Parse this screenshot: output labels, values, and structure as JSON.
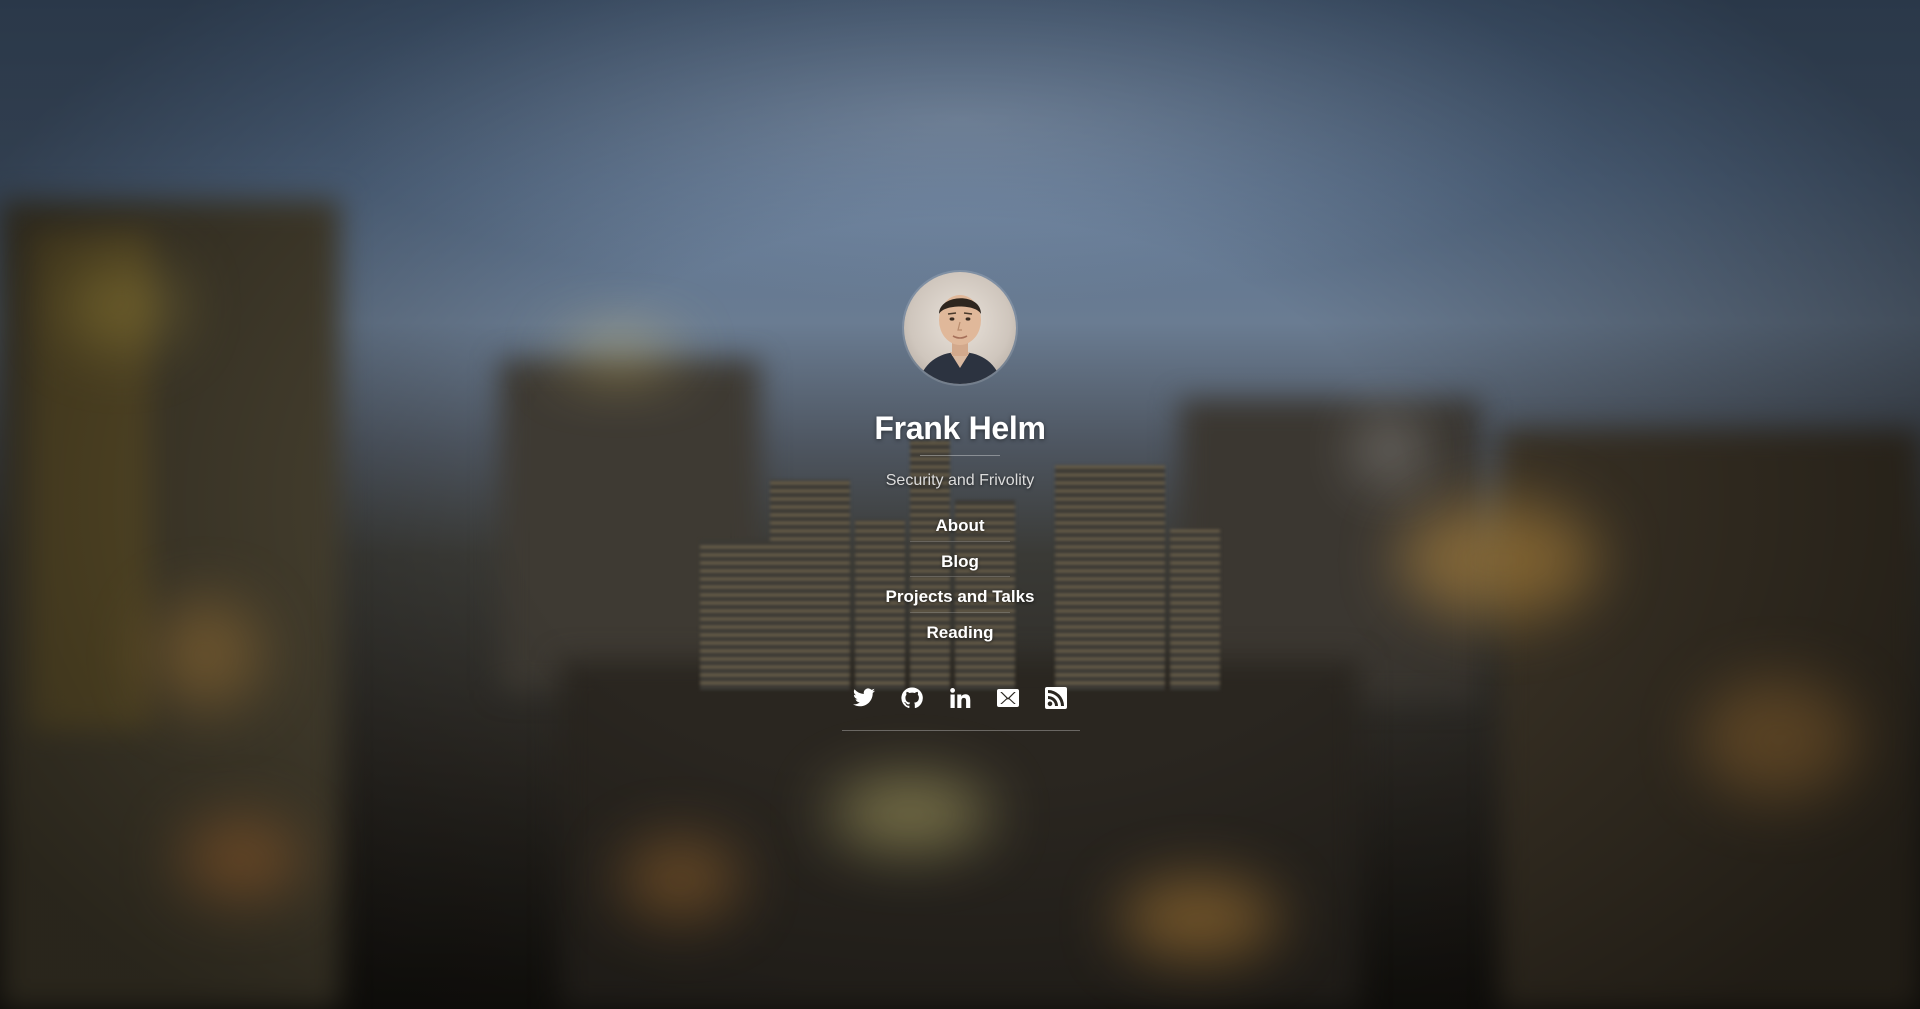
{
  "profile": {
    "name": "Frank Helm",
    "tagline": "Security and Frivolity"
  },
  "nav": {
    "items": [
      {
        "label": "About"
      },
      {
        "label": "Blog"
      },
      {
        "label": "Projects and Talks"
      },
      {
        "label": "Reading"
      }
    ]
  },
  "social": {
    "icons": [
      "twitter-icon",
      "github-icon",
      "linkedin-icon",
      "email-icon",
      "rss-icon"
    ]
  },
  "colors": {
    "text": "#ffffff",
    "tagline": "#dcdcdc"
  }
}
